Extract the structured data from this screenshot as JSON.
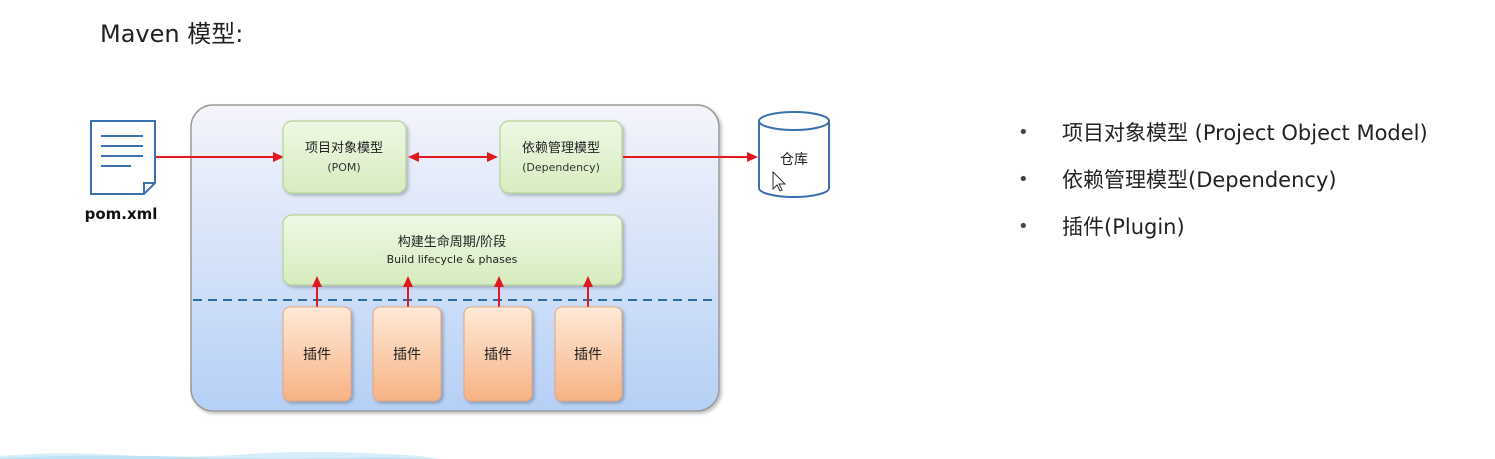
{
  "title": "Maven 模型:",
  "file_label": "pom.xml",
  "repository_label": "仓库",
  "project_model": {
    "name": "项目对象模型",
    "abbr": "(POM)"
  },
  "dependency_model": {
    "name": "依赖管理模型",
    "abbr": "(Dependency)"
  },
  "lifecycle": {
    "name": "构建生命周期/阶段",
    "english": "Build lifecycle & phases"
  },
  "plugins": [
    "插件",
    "插件",
    "插件",
    "插件"
  ],
  "bullets": [
    "项目对象模型 (Project Object Model)",
    "依赖管理模型(Dependency)",
    "插件(Plugin)"
  ],
  "colors": {
    "arrow": "#e0191e",
    "container_top": "#f3f3fb",
    "container_bottom": "#b7d1f7",
    "green_box": "#e2f2d0",
    "green_border": "#b9d79b",
    "plugin_top": "#fde3cf",
    "plugin_bottom": "#f8b98e",
    "dashed_line": "#2d6aa8"
  }
}
